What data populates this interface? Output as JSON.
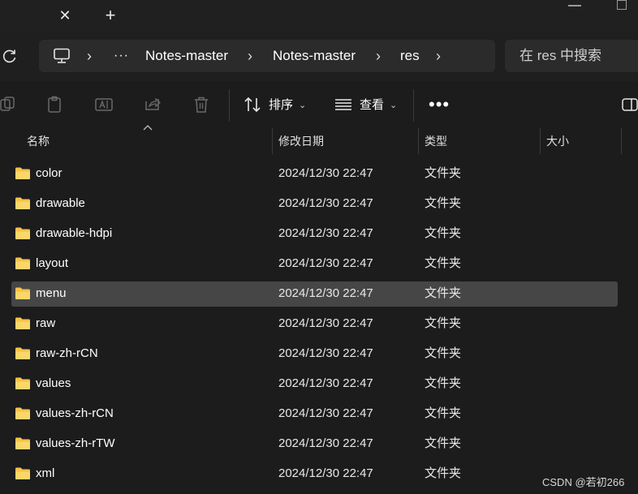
{
  "window": {
    "tab_close_glyph": "✕",
    "tab_new_glyph": "+"
  },
  "address_bar": {
    "overflow_label": "···",
    "crumbs": [
      "Notes-master",
      "Notes-master",
      "res"
    ],
    "chevron_glyph": "›"
  },
  "search": {
    "placeholder": "在 res 中搜索"
  },
  "toolbar": {
    "sort_label": "排序",
    "view_label": "查看",
    "more_label": "•••",
    "caret_glyph": "⌄"
  },
  "columns": {
    "name": "名称",
    "modified": "修改日期",
    "type": "类型",
    "size": "大小"
  },
  "files": [
    {
      "name": "color",
      "modified": "2024/12/30 22:47",
      "type": "文件夹",
      "size": "",
      "selected": false
    },
    {
      "name": "drawable",
      "modified": "2024/12/30 22:47",
      "type": "文件夹",
      "size": "",
      "selected": false
    },
    {
      "name": "drawable-hdpi",
      "modified": "2024/12/30 22:47",
      "type": "文件夹",
      "size": "",
      "selected": false
    },
    {
      "name": "layout",
      "modified": "2024/12/30 22:47",
      "type": "文件夹",
      "size": "",
      "selected": false
    },
    {
      "name": "menu",
      "modified": "2024/12/30 22:47",
      "type": "文件夹",
      "size": "",
      "selected": true
    },
    {
      "name": "raw",
      "modified": "2024/12/30 22:47",
      "type": "文件夹",
      "size": "",
      "selected": false
    },
    {
      "name": "raw-zh-rCN",
      "modified": "2024/12/30 22:47",
      "type": "文件夹",
      "size": "",
      "selected": false
    },
    {
      "name": "values",
      "modified": "2024/12/30 22:47",
      "type": "文件夹",
      "size": "",
      "selected": false
    },
    {
      "name": "values-zh-rCN",
      "modified": "2024/12/30 22:47",
      "type": "文件夹",
      "size": "",
      "selected": false
    },
    {
      "name": "values-zh-rTW",
      "modified": "2024/12/30 22:47",
      "type": "文件夹",
      "size": "",
      "selected": false
    },
    {
      "name": "xml",
      "modified": "2024/12/30 22:47",
      "type": "文件夹",
      "size": "",
      "selected": false
    }
  ],
  "watermark": "CSDN @若初266",
  "colors": {
    "background": "#1c1c1c",
    "selection": "#464646",
    "folder": "#f4c34a"
  }
}
